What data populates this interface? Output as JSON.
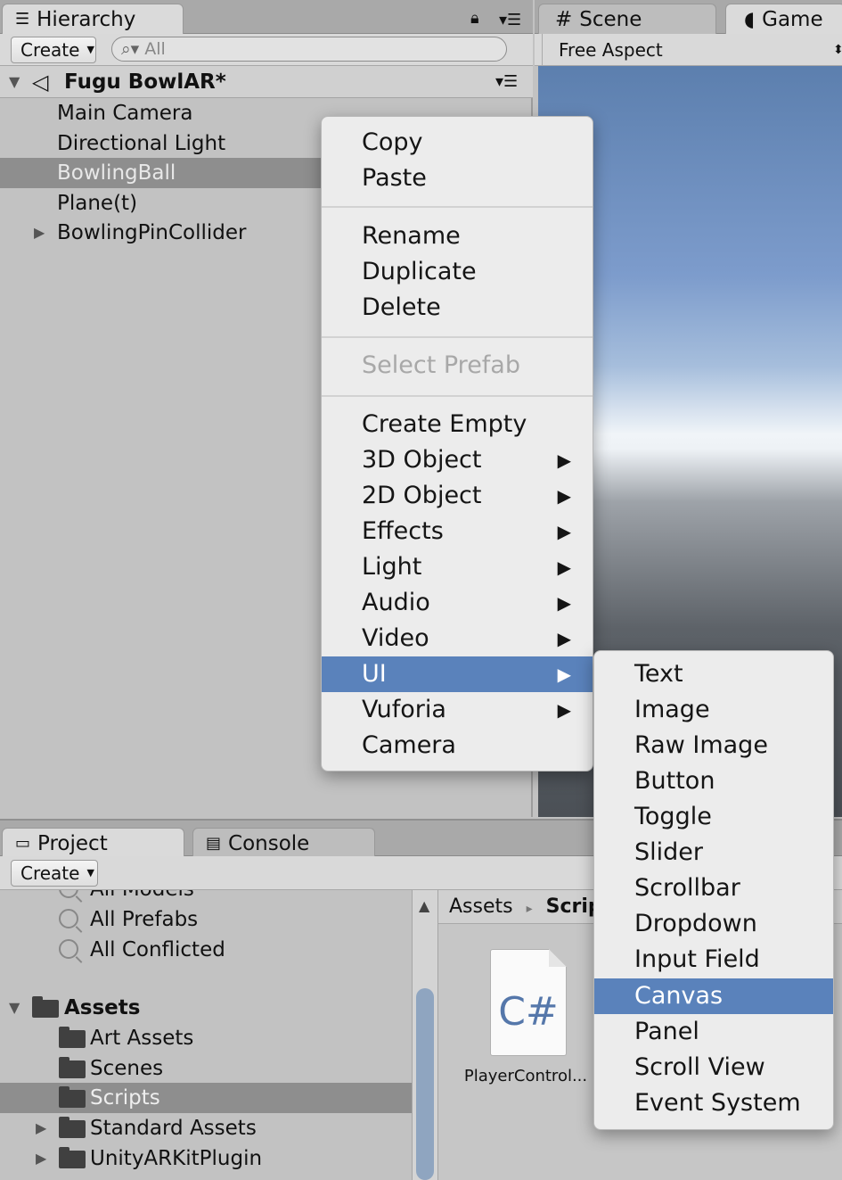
{
  "hierarchy": {
    "tab_label": "Hierarchy",
    "create_label": "Create",
    "search_placeholder": "All",
    "scene_name": "Fugu BowlAR*",
    "items": [
      {
        "label": "Main Camera"
      },
      {
        "label": "Directional Light"
      },
      {
        "label": "BowlingBall",
        "selected": true
      },
      {
        "label": "Plane(t)"
      },
      {
        "label": "BowlingPinCollider",
        "collapsed_children": true
      }
    ]
  },
  "scene_view": {
    "scene_tab": "Scene",
    "game_tab": "Game",
    "aspect_label": "Free Aspect"
  },
  "context_menu": {
    "items": [
      {
        "label": "Copy"
      },
      {
        "label": "Paste"
      },
      {
        "label": "Rename"
      },
      {
        "label": "Duplicate"
      },
      {
        "label": "Delete"
      },
      {
        "label": "Select Prefab",
        "disabled": true
      },
      {
        "label": "Create Empty"
      },
      {
        "label": "3D Object",
        "submenu": true
      },
      {
        "label": "2D Object",
        "submenu": true
      },
      {
        "label": "Effects",
        "submenu": true
      },
      {
        "label": "Light",
        "submenu": true
      },
      {
        "label": "Audio",
        "submenu": true
      },
      {
        "label": "Video",
        "submenu": true
      },
      {
        "label": "UI",
        "submenu": true,
        "highlighted": true
      },
      {
        "label": "Vuforia",
        "submenu": true
      },
      {
        "label": "Camera"
      }
    ]
  },
  "ui_submenu": {
    "items": [
      {
        "label": "Text"
      },
      {
        "label": "Image"
      },
      {
        "label": "Raw Image"
      },
      {
        "label": "Button"
      },
      {
        "label": "Toggle"
      },
      {
        "label": "Slider"
      },
      {
        "label": "Scrollbar"
      },
      {
        "label": "Dropdown"
      },
      {
        "label": "Input Field"
      },
      {
        "label": "Canvas",
        "highlighted": true
      },
      {
        "label": "Panel"
      },
      {
        "label": "Scroll View"
      },
      {
        "label": "Event System"
      }
    ]
  },
  "project": {
    "project_tab": "Project",
    "console_tab": "Console",
    "create_label": "Create",
    "favorites": [
      {
        "label": "All Models"
      },
      {
        "label": "All Prefabs"
      },
      {
        "label": "All Conflicted"
      }
    ],
    "assets_label": "Assets",
    "folders": [
      {
        "label": "Art Assets"
      },
      {
        "label": "Scenes"
      },
      {
        "label": "Scripts",
        "selected": true
      },
      {
        "label": "Standard Assets",
        "collapsed_children": true
      },
      {
        "label": "UnityARKitPlugin",
        "collapsed_children": true
      }
    ],
    "breadcrumb": [
      "Assets",
      "Scripts"
    ],
    "breadcrumb_separator": "▸",
    "file": {
      "icon_text": "C#",
      "label": "PlayerControl..."
    }
  },
  "colors": {
    "selection_blue": "#5a82bb",
    "selected_row_gray": "#8e8e8e",
    "panel_gray": "#c2c2c2"
  }
}
